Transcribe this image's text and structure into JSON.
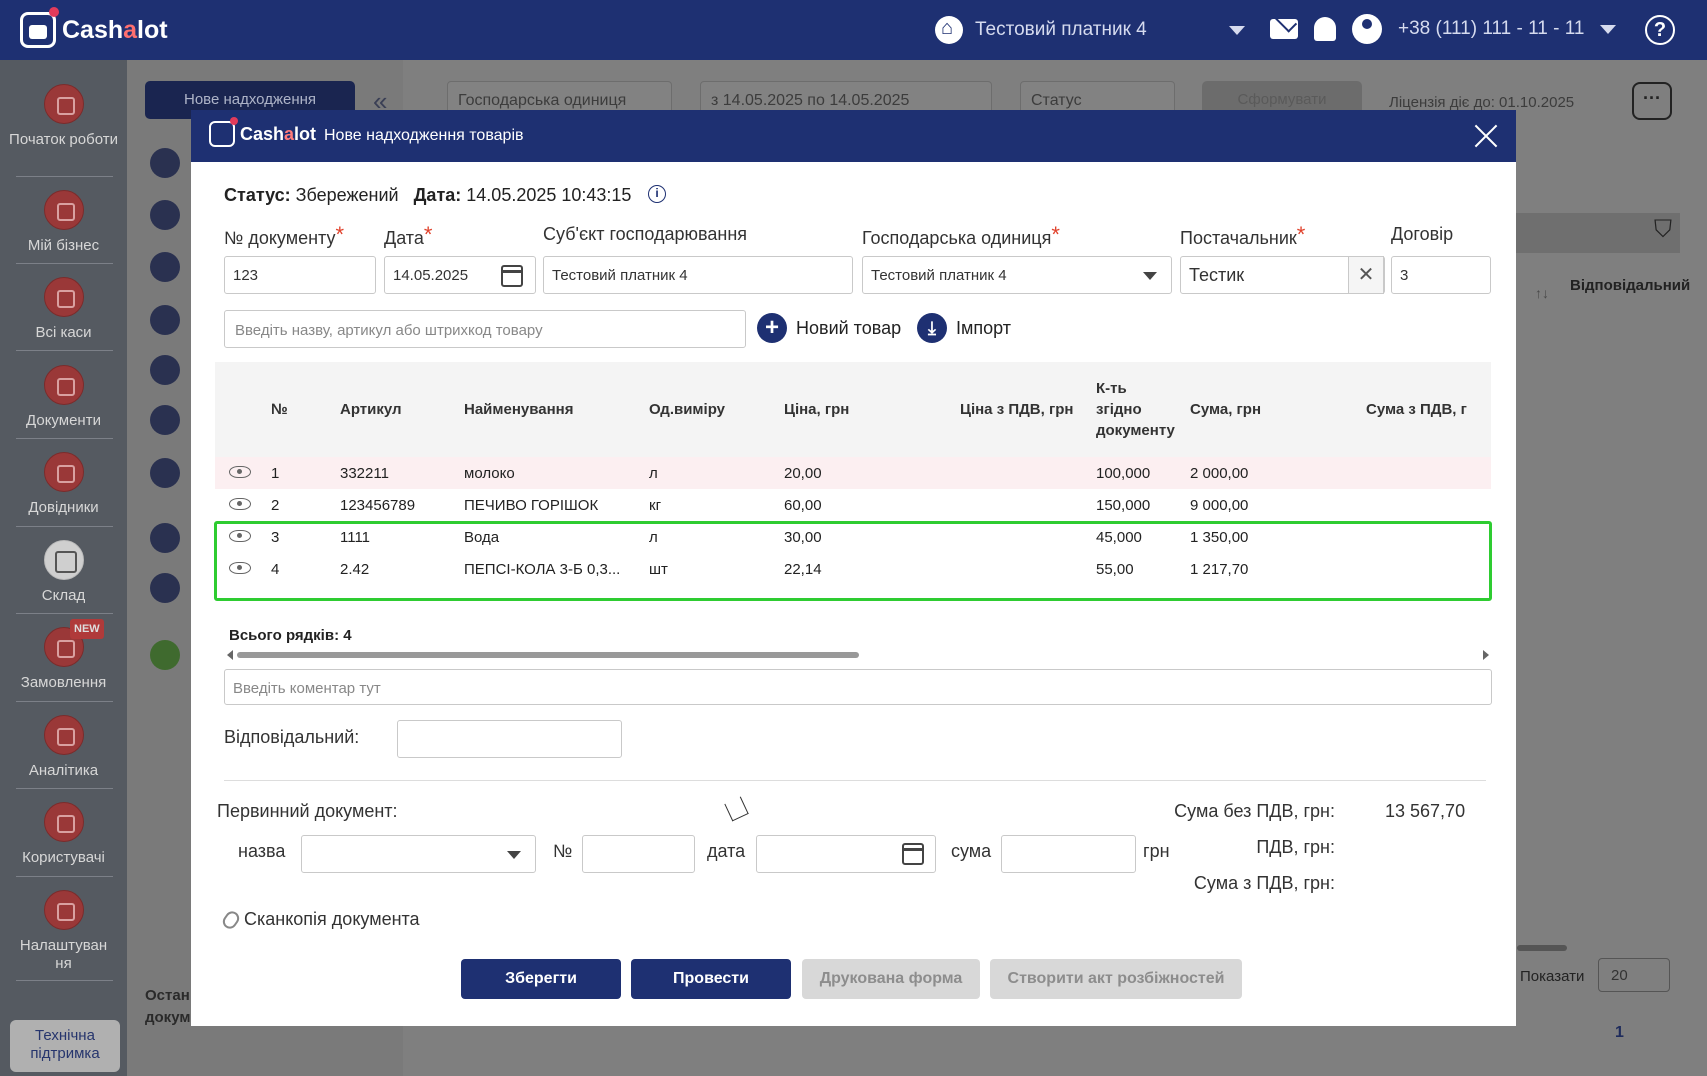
{
  "app": {
    "logo_text_a": "Cash",
    "logo_text_b": "a",
    "logo_text_c": "lot",
    "company": "Тестовий платник 4",
    "phone": "+38 (111) 111 - 11 - 11",
    "help": "?"
  },
  "sidebar": {
    "items": [
      {
        "label": "Початок роботи"
      },
      {
        "label": "Мій бізнес"
      },
      {
        "label": "Всі каси"
      },
      {
        "label": "Документи"
      },
      {
        "label": "Довідники"
      },
      {
        "label": "Склад"
      },
      {
        "label": "Замовлення"
      },
      {
        "label": "Аналітика"
      },
      {
        "label": "Користувачі"
      },
      {
        "label": "Налаштуван ня"
      }
    ],
    "new_badge": "NEW",
    "support": "Технічна підтримка"
  },
  "background": {
    "new_receipt_button": "Нове надходження",
    "collapse": "«",
    "filter_unit": "Господарська одиниця",
    "filter_dates": "з 14.05.2025 по 14.05.2025",
    "filter_status": "Статус",
    "form_button": "Сформувати",
    "license": "Ліцензія діє до: 01.10.2025",
    "more": "···",
    "column_responsible": "Відповідальний",
    "show_label": "Показати",
    "page_size": "20",
    "page_number": "1",
    "remainder_text": "Остан докум"
  },
  "modal": {
    "logo_a": "Cash",
    "logo_b": "a",
    "logo_c": "lot",
    "title": "Нове надходження товарів",
    "status_label": "Статус:",
    "status_value": "Збережений",
    "date_label": "Дата:",
    "date_value": "14.05.2025 10:43:15",
    "info": "i",
    "fields": {
      "doc_no_label": "№ документу",
      "doc_no_value": "123",
      "date_label": "Дата",
      "date_value": "14.05.2025",
      "subject_label": "Суб'єкт господарювання",
      "subject_value": "Тестовий платник 4",
      "unit_label": "Господарська одиниця",
      "unit_value": "Тестовий платник 4",
      "supplier_label": "Постачальник",
      "supplier_value": "Тестик",
      "contract_label": "Договір",
      "contract_value": "3",
      "required_mark": "*"
    },
    "search_placeholder": "Введіть назву, артикул або штрихкод товару",
    "new_product": "Новий товар",
    "import": "Імпорт",
    "table": {
      "columns": [
        "№",
        "Артикул",
        "Найменування",
        "Од.виміру",
        "Ціна, грн",
        "Ціна з ПДВ, грн",
        "К-ть згідно документу",
        "Сума, грн",
        "Сума з ПДВ, г"
      ],
      "qty_header_lines": [
        "К-ть",
        "згідно",
        "документу"
      ],
      "rows": [
        {
          "n": "1",
          "sku": "332211",
          "name": "молоко",
          "unit": "л",
          "price": "20,00",
          "price_vat": "",
          "qty": "100,000",
          "sum": "2 000,00",
          "sum_vat": ""
        },
        {
          "n": "2",
          "sku": "123456789",
          "name": "ПЕЧИВО ГОРІШОК",
          "unit": "кг",
          "price": "60,00",
          "price_vat": "",
          "qty": "150,000",
          "sum": "9 000,00",
          "sum_vat": ""
        },
        {
          "n": "3",
          "sku": "1111",
          "name": "Вода",
          "unit": "л",
          "price": "30,00",
          "price_vat": "",
          "qty": "45,000",
          "sum": "1 350,00",
          "sum_vat": ""
        },
        {
          "n": "4",
          "sku": "2.42",
          "name": "ПЕПСІ-КОЛА 3-Б 0,3...",
          "unit": "шт",
          "price": "22,14",
          "price_vat": "",
          "qty": "55,00",
          "sum": "1 217,70",
          "sum_vat": ""
        }
      ],
      "total_rows": "Всього рядків: 4"
    },
    "comment_placeholder": "Введіть коментар тут",
    "responsible_label": "Відповідальний:",
    "primary_doc_label": "Первинний документ:",
    "primary_name_label": "назва",
    "primary_no_label": "№",
    "primary_date_label": "дата",
    "primary_sum_label": "сума",
    "primary_currency": "грн",
    "sum_no_vat_label": "Сума без ПДВ, грн:",
    "sum_no_vat_value": "13 567,70",
    "vat_label": "ПДВ, грн:",
    "sum_vat_label": "Сума з ПДВ, грн:",
    "scan_label": "Сканкопія документа",
    "buttons": {
      "save": "Зберегти",
      "post": "Провести",
      "print": "Друкована форма",
      "discrepancy": "Створити акт розбіжностей"
    }
  },
  "colors": {
    "primary": "#1e3072",
    "highlight": "#2ecc31",
    "required": "#e0412b"
  }
}
